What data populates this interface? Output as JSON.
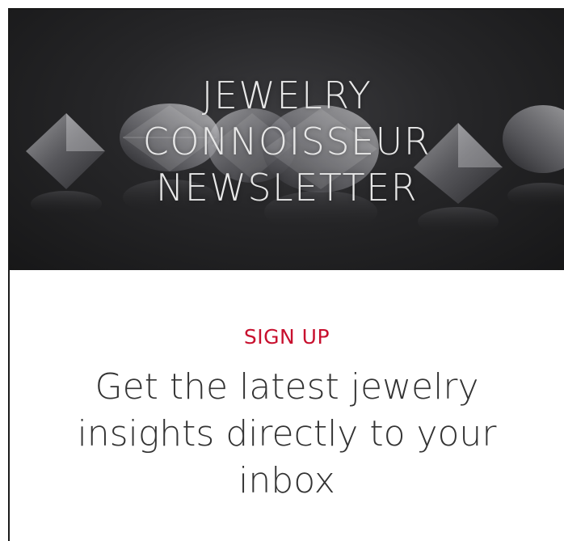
{
  "hero": {
    "title_lines": [
      "JEWELRY",
      "CONNOISSEUR",
      "NEWSLETTER"
    ],
    "background_image": "loose-diamonds-on-dark-surface"
  },
  "signup": {
    "eyebrow": "SIGN UP",
    "heading": "Get the latest jewelry insights directly to your inbox"
  },
  "colors": {
    "eyebrow": "#c8102e",
    "heading": "#333333",
    "hero_text": "#e7e7e7",
    "hero_background": "#262628"
  }
}
